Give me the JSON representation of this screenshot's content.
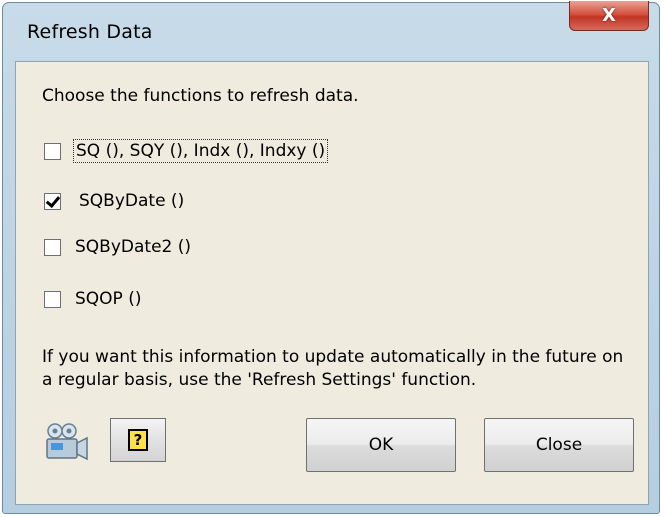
{
  "window": {
    "title": "Refresh Data",
    "close_glyph": "X"
  },
  "intro_text": "Choose the functions to refresh data.",
  "options": [
    {
      "label": "SQ (), SQY (), Indx (), Indxy ()",
      "checked": false,
      "focused": true
    },
    {
      "label": "SQByDate ()",
      "checked": true,
      "focused": false
    },
    {
      "label": "SQByDate2 ()",
      "checked": false,
      "focused": false
    },
    {
      "label": "SQOP ()",
      "checked": false,
      "focused": false
    }
  ],
  "info_text": "If you want this information to update automatically in the future on a regular basis, use the 'Refresh Settings' function.",
  "buttons": {
    "help_glyph": "?",
    "ok_label": "OK",
    "close_label": "Close"
  },
  "icons": {
    "video": "video-camera-icon",
    "help": "help-icon",
    "close": "close-icon"
  }
}
